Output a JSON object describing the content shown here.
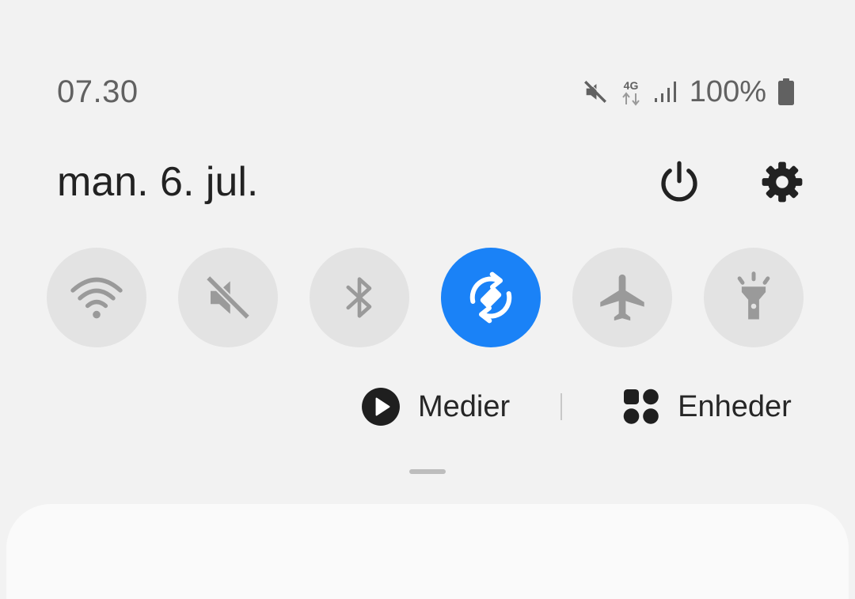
{
  "status_bar": {
    "time": "07.30",
    "network": "4G",
    "battery": "100%"
  },
  "header": {
    "date": "man. 6. jul."
  },
  "quick_tiles": [
    {
      "name": "wifi",
      "icon": "wifi-icon",
      "active": false
    },
    {
      "name": "sound",
      "icon": "mute-icon",
      "active": false
    },
    {
      "name": "bluetooth",
      "icon": "bluetooth-icon",
      "active": false
    },
    {
      "name": "auto-rotate",
      "icon": "auto-rotate-icon",
      "active": true
    },
    {
      "name": "airplane-mode",
      "icon": "airplane-icon",
      "active": false
    },
    {
      "name": "flashlight",
      "icon": "flashlight-icon",
      "active": false
    }
  ],
  "media_row": {
    "media_label": "Medier",
    "devices_label": "Enheder"
  },
  "colors": {
    "background": "#f2f2f2",
    "tile_inactive": "#e3e3e3",
    "tile_active": "#1a82f7",
    "icon_inactive": "#9a9a9a"
  }
}
